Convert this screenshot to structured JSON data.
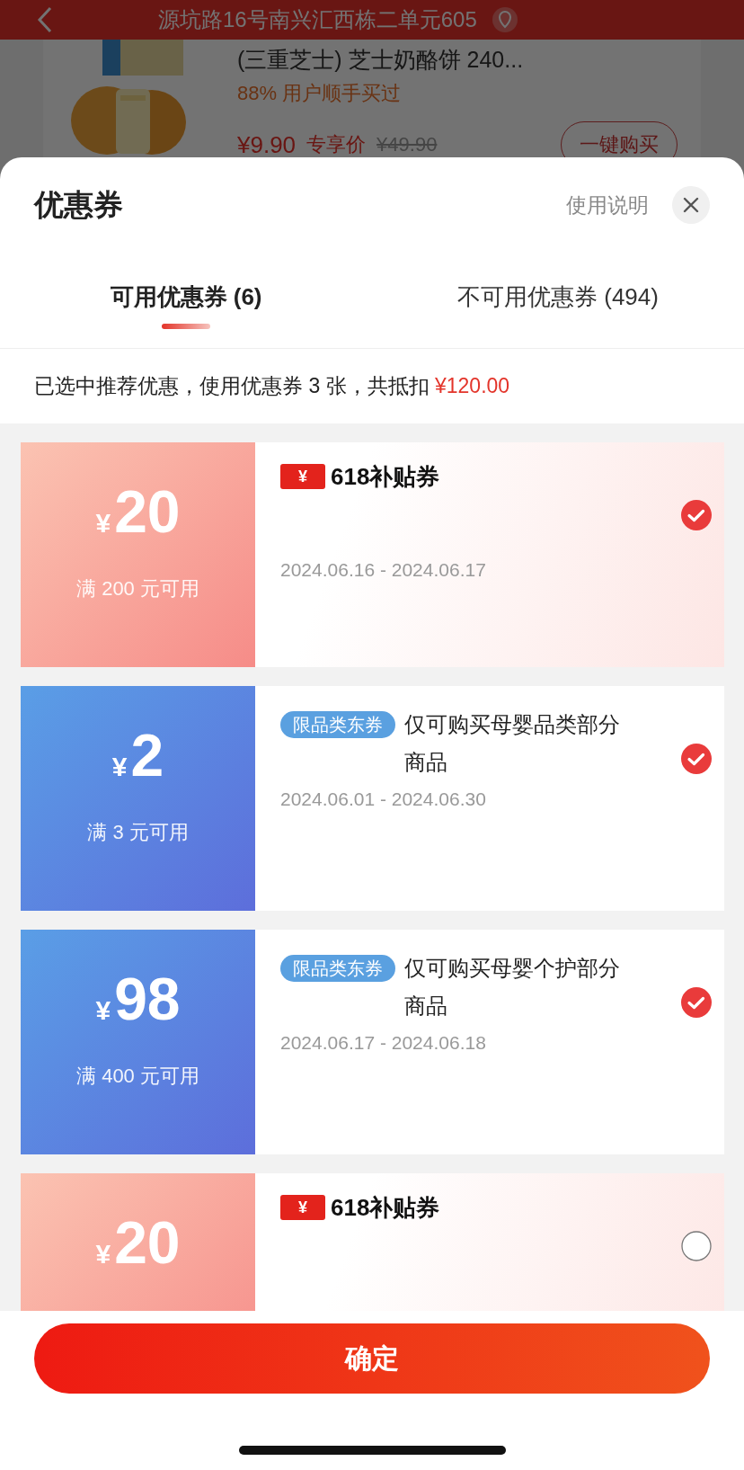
{
  "background_page": {
    "address": "源坑路16号南兴汇西栋二单元605",
    "product": {
      "title": "(三重芝士) 芝士奶酪饼 240...",
      "social_proof": "88% 用户顺手买过",
      "price": "¥9.90",
      "price_label": "专享价",
      "original_price": "¥49.90",
      "buy_button": "一键购买"
    }
  },
  "sheet": {
    "title": "优惠券",
    "help_link": "使用说明",
    "tabs": [
      {
        "label": "可用优惠券 (6)",
        "selected": true
      },
      {
        "label": "不可用优惠券 (494)",
        "selected": false
      }
    ],
    "summary": {
      "text": "已选中推荐优惠，使用优惠券 3 张，共抵扣 ",
      "amount": "¥120.00"
    },
    "coupons": [
      {
        "kind": "subsidy",
        "currency": "¥",
        "amount": "20",
        "condition": "满 200 元可用",
        "badge_symbol": "¥",
        "badge_text": "618补贴券",
        "dates": "2024.06.16 - 2024.06.17",
        "checked": true
      },
      {
        "kind": "category",
        "currency": "¥",
        "amount": "2",
        "condition": "满 3 元可用",
        "tag": "限品类东券",
        "description": "仅可购买母婴品类部分商品",
        "dates": "2024.06.01 - 2024.06.30",
        "checked": true
      },
      {
        "kind": "category",
        "currency": "¥",
        "amount": "98",
        "condition": "满 400 元可用",
        "tag": "限品类东券",
        "description": "仅可购买母婴个护部分商品",
        "dates": "2024.06.17 - 2024.06.18",
        "checked": true
      },
      {
        "kind": "subsidy",
        "currency": "¥",
        "amount": "20",
        "badge_symbol": "¥",
        "badge_text": "618补贴券",
        "checked": false
      }
    ],
    "confirm_button": "确定"
  }
}
